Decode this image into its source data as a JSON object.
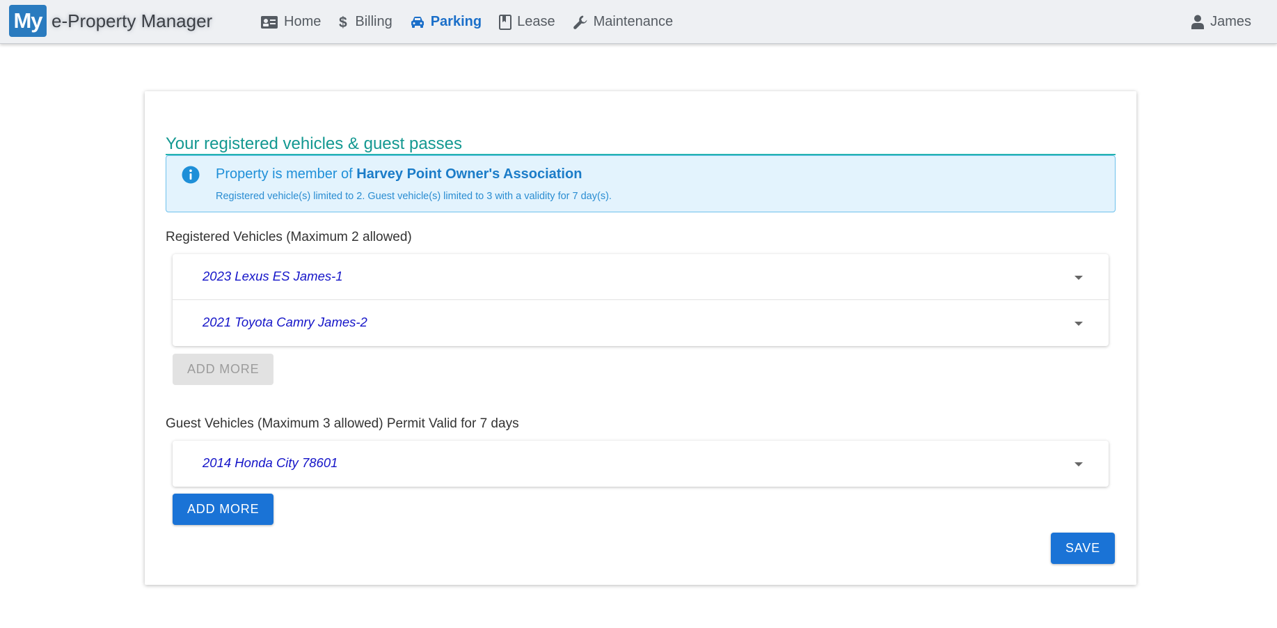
{
  "header": {
    "logo_text": "My",
    "app_title": "e-Property Manager",
    "nav": [
      {
        "label": "Home",
        "icon": "id-card-icon",
        "active": false
      },
      {
        "label": "Billing",
        "icon": "dollar-icon",
        "active": false
      },
      {
        "label": "Parking",
        "icon": "car-icon",
        "active": true
      },
      {
        "label": "Lease",
        "icon": "bookmark-icon",
        "active": false
      },
      {
        "label": "Maintenance",
        "icon": "wrench-icon",
        "active": false
      }
    ],
    "user_name": "James"
  },
  "main": {
    "title": "Your registered vehicles & guest passes",
    "alert": {
      "prefix": "Property is member of ",
      "association": "Harvey Point Owner's Association",
      "detail": "Registered vehicle(s) limited to 2. Guest vehicle(s) limited to 3 with a validity for 7 day(s)."
    },
    "registered": {
      "label": "Registered Vehicles (Maximum 2 allowed)",
      "vehicles": [
        "2023 Lexus ES James-1",
        "2021 Toyota Camry James-2"
      ],
      "add_more_label": "ADD MORE",
      "add_more_disabled": true
    },
    "guest": {
      "label": "Guest Vehicles (Maximum 3 allowed) Permit Valid for 7 days",
      "vehicles": [
        "2014 Honda City 78601"
      ],
      "add_more_label": "ADD MORE",
      "add_more_disabled": false
    },
    "save_label": "SAVE"
  },
  "colors": {
    "accent": "#1a73d6",
    "title_teal": "#139891",
    "alert_bg": "#e3f3fd",
    "vehicle_text": "#1414c8"
  }
}
